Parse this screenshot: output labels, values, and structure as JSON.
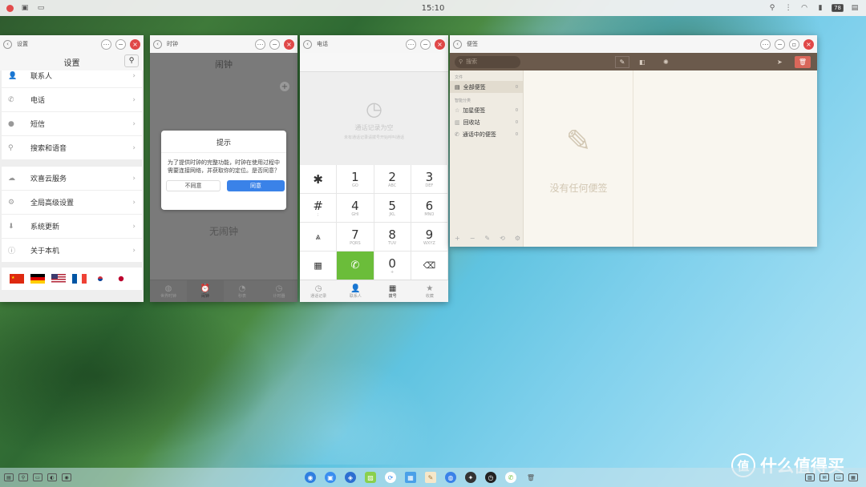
{
  "topbar": {
    "clock": "15:10",
    "battery": "78"
  },
  "settings": {
    "title": "设置",
    "heading": "设置",
    "group1": [
      {
        "label": "联系人",
        "icon": "person-icon"
      },
      {
        "label": "电话",
        "icon": "phone-icon"
      },
      {
        "label": "短信",
        "icon": "message-icon"
      },
      {
        "label": "搜索和语音",
        "icon": "search-icon"
      }
    ],
    "group2": [
      {
        "label": "欢喜云服务",
        "icon": "cloud-icon"
      },
      {
        "label": "全局高级设置",
        "icon": "gear-icon"
      },
      {
        "label": "系统更新",
        "icon": "update-icon"
      },
      {
        "label": "关于本机",
        "icon": "info-icon"
      }
    ],
    "flags": [
      "cn",
      "de",
      "us",
      "fr",
      "kr",
      "jp"
    ]
  },
  "clock_app": {
    "title": "时钟",
    "heading": "闹钟",
    "empty": "无闹钟",
    "dialog": {
      "title": "提示",
      "message": "为了提供时钟的完整功能，时钟在使用过程中需要连接网络，并获取你的定位。是否同意？",
      "disagree": "不同意",
      "agree": "同意"
    },
    "tabs": [
      "世界时钟",
      "闹钟",
      "秒表",
      "计时器"
    ]
  },
  "phone": {
    "title": "电话",
    "empty_title": "通话记录为空",
    "empty_sub": "未有通话记录请拨号开始呼叫通话",
    "keys": [
      {
        "d": "1",
        "l": "GO"
      },
      {
        "d": "2",
        "l": "ABC"
      },
      {
        "d": "3",
        "l": "DEF"
      },
      {
        "d": "4",
        "l": "GHI"
      },
      {
        "d": "5",
        "l": "JKL"
      },
      {
        "d": "6",
        "l": "MNO"
      },
      {
        "d": "7",
        "l": "PQRS"
      },
      {
        "d": "8",
        "l": "TUV"
      },
      {
        "d": "9",
        "l": "WXYZ"
      },
      {
        "d": "0",
        "l": "+"
      }
    ],
    "tabs": [
      "通话记录",
      "联系人",
      "拨号",
      "收藏"
    ]
  },
  "memo": {
    "title": "便签",
    "search_placeholder": "搜索",
    "section1": "文件",
    "all": "全部便签",
    "all_count": "0",
    "section2": "智能分类",
    "items": [
      {
        "label": "加星便签",
        "count": "0"
      },
      {
        "label": "回收站",
        "count": "0"
      },
      {
        "label": "通话中的便签",
        "count": "0"
      }
    ],
    "empty": "没有任何便签"
  },
  "watermark": {
    "text": "什么值得买",
    "mark": "值"
  },
  "colors": {
    "accent": "#3a82e8",
    "close": "#e04848",
    "memo_bar": "#6b5a4c",
    "call": "#6bbd3a"
  }
}
